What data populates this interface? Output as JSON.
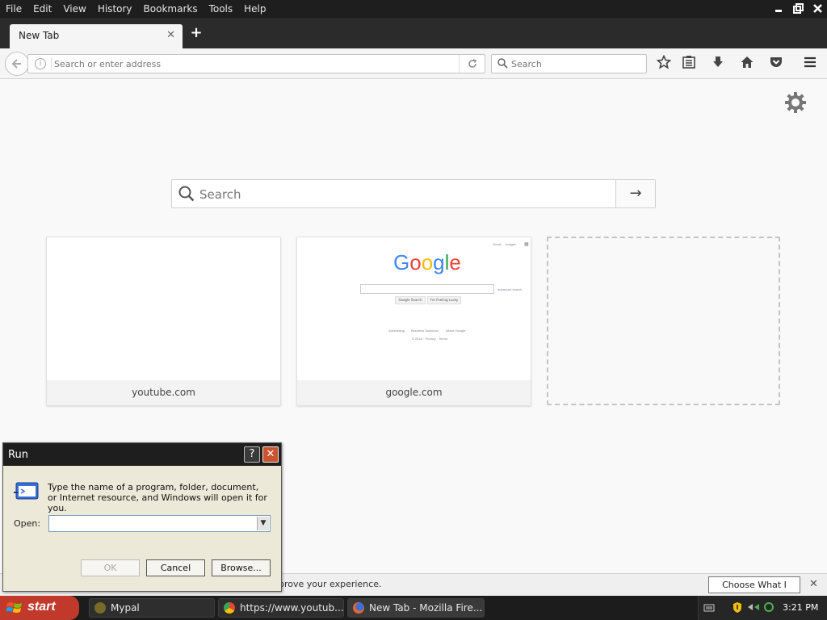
{
  "menubar": {
    "items": [
      "File",
      "Edit",
      "View",
      "History",
      "Bookmarks",
      "Tools",
      "Help"
    ]
  },
  "window_controls": {
    "minimize": "minimize-icon",
    "restore": "restore-icon",
    "close": "close-icon"
  },
  "tab": {
    "title": "New Tab",
    "close_glyph": "✕",
    "new_tab_glyph": "+"
  },
  "navbar": {
    "address_placeholder": "Search or enter address",
    "search_placeholder": "Search",
    "icons": [
      "back-arrow-icon",
      "info-icon",
      "reload-icon",
      "search-icon",
      "bookmark-star-icon",
      "reading-list-icon",
      "download-icon",
      "home-icon",
      "pocket-icon",
      "hamburger-menu-icon"
    ]
  },
  "newtab_page": {
    "search_placeholder": "Search",
    "go_glyph": "→",
    "tiles": [
      {
        "label": "youtube.com"
      },
      {
        "label": "google.com"
      },
      {
        "label": ""
      }
    ],
    "google_thumb": {
      "logo": "Google",
      "top_links": [
        "Gmail",
        "Images"
      ],
      "search_btn": "Google Search",
      "lucky_btn": "I'm Feeling Lucky",
      "footer_links": [
        "Advertising",
        "Business Solutions",
        "About Google"
      ]
    }
  },
  "notification": {
    "message": "prove your experience.",
    "button": "Choose What I Share",
    "close_glyph": "✕"
  },
  "run_dialog": {
    "title": "Run",
    "help_glyph": "?",
    "close_glyph": "✕",
    "description": "Type the name of a program, folder, document, or Internet resource, and Windows will open it for you.",
    "open_label": "Open:",
    "open_value": "",
    "ok": "OK",
    "cancel": "Cancel",
    "browse": "Browse..."
  },
  "taskbar": {
    "start": "start",
    "tasks": [
      {
        "label": "Mypal",
        "icon": "mypal-icon"
      },
      {
        "label": "https://www.youtub...",
        "icon": "chrome-icon"
      },
      {
        "label": "New Tab - Mozilla Fire...",
        "icon": "firefox-icon"
      }
    ],
    "clock": "3:21 PM"
  },
  "colors": {
    "start": "#c0392b",
    "google_blue": "#4285f4",
    "google_red": "#ea4335",
    "google_yellow": "#fbbc05",
    "google_green": "#34a853"
  }
}
